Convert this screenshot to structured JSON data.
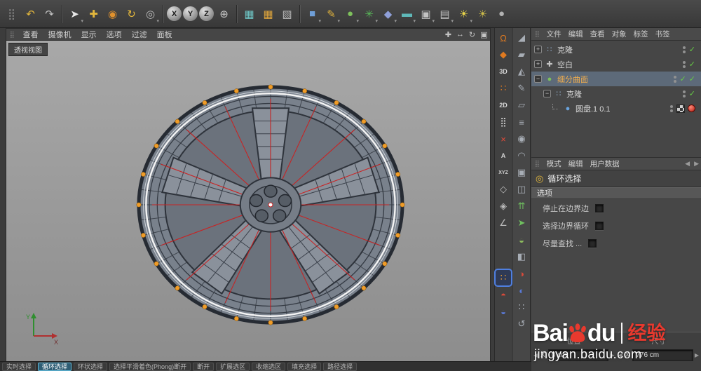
{
  "top_toolbar": {
    "icons": [
      {
        "n": "palette-grip-icon",
        "g": "⣿",
        "c": "#828282"
      },
      {
        "n": "undo-icon",
        "g": "↶",
        "c": "#e3b73c"
      },
      {
        "n": "redo-icon",
        "g": "↷",
        "c": "#c2c2c2"
      },
      {
        "n": "sep"
      },
      {
        "n": "live-selection-icon",
        "g": "➤",
        "c": "#e8e8e8",
        "caret": true
      },
      {
        "n": "move-tool-icon",
        "g": "✚",
        "c": "#e3b73c"
      },
      {
        "n": "scale-tool-icon",
        "g": "◉",
        "c": "#e0912d"
      },
      {
        "n": "rotate-tool-icon",
        "g": "↻",
        "c": "#e3b73c"
      },
      {
        "n": "last-tool-icon",
        "g": "◎",
        "c": "#bcbcbc",
        "caret": true
      },
      {
        "n": "sep"
      },
      {
        "n": "lock-x-button",
        "g": "X",
        "ball": true
      },
      {
        "n": "lock-y-button",
        "g": "Y",
        "ball": true
      },
      {
        "n": "lock-z-button",
        "g": "Z",
        "ball": true
      },
      {
        "n": "coord-system-button",
        "g": "⊕",
        "c": "#c8c8c8"
      },
      {
        "n": "sep"
      },
      {
        "n": "render-view-button",
        "g": "▦",
        "c": "#6fc7c7"
      },
      {
        "n": "render-picture-button",
        "g": "▦",
        "c": "#e0a63c"
      },
      {
        "n": "render-settings-button",
        "g": "▧",
        "c": "#bcbcbc"
      },
      {
        "n": "sep"
      },
      {
        "n": "primitive-cube-button",
        "g": "■",
        "c": "#6f9fd8",
        "caret": true
      },
      {
        "n": "spline-pen-button",
        "g": "✎",
        "c": "#e0b23c",
        "caret": true
      },
      {
        "n": "subdivision-surface-button",
        "g": "●",
        "c": "#7ec15c",
        "caret": true
      },
      {
        "n": "mograph-button",
        "g": "✳",
        "c": "#58b858",
        "caret": true
      },
      {
        "n": "deformer-button",
        "g": "◆",
        "c": "#8f9fd8",
        "caret": true
      },
      {
        "n": "environment-button",
        "g": "▬",
        "c": "#5fb8b8",
        "caret": true
      },
      {
        "n": "camera-button",
        "g": "▣",
        "c": "#c2c2c2",
        "caret": true
      },
      {
        "n": "display-button",
        "g": "▤",
        "c": "#c2c2c2",
        "caret": true
      },
      {
        "n": "light-button",
        "g": "☀",
        "c": "#e8d44a",
        "caret": true
      },
      {
        "n": "light2-button",
        "g": "☀",
        "c": "#c8b84a"
      },
      {
        "n": "material-sphere-button",
        "g": "●",
        "c": "#b2b2b2"
      }
    ]
  },
  "viewport": {
    "menu": [
      "查看",
      "摄像机",
      "显示",
      "选项",
      "过滤",
      "面板"
    ],
    "view_label": "透视视图",
    "view_controls": [
      {
        "n": "pan-view-icon",
        "g": "✚"
      },
      {
        "n": "zoom-view-icon",
        "g": "↔"
      },
      {
        "n": "rotate-view-icon",
        "g": "↻"
      },
      {
        "n": "toggle-view-icon",
        "g": "▣"
      }
    ],
    "axis_labels": {
      "x": "X",
      "y": "Y"
    }
  },
  "tool_column_a": {
    "icons": [
      {
        "n": "snap-enable-icon",
        "g": "Ω",
        "c": "#e07a20"
      },
      {
        "n": "snap-vertex-icon",
        "g": "◆",
        "c": "#e07a20"
      },
      {
        "n": "snap-3d-icon",
        "g": "3D",
        "c": "#d8d8d8",
        "txt": true
      },
      {
        "n": "snap-grid-icon",
        "g": "∷",
        "c": "#e07a20"
      },
      {
        "n": "snap-2d-icon",
        "g": "2D",
        "c": "#d8d8d8",
        "txt": true
      },
      {
        "n": "grid-points-icon",
        "g": "⣿",
        "c": "#d2d2d2"
      },
      {
        "n": "snap-disable-icon",
        "g": "×",
        "c": "#e04a3a"
      },
      {
        "n": "auto-mode-icon",
        "g": "A",
        "c": "#d2d2d2",
        "txt": true
      },
      {
        "n": "axis-xyz-icon",
        "g": "XYZ",
        "c": "#d2d2d2",
        "small": true
      },
      {
        "n": "workplane-icon",
        "g": "◇",
        "c": "#bababa"
      },
      {
        "n": "workplane-lock-icon",
        "g": "◈",
        "c": "#bababa"
      },
      {
        "n": "quantize-icon",
        "g": "∠",
        "c": "#bababa"
      },
      {
        "n": "gap"
      },
      {
        "n": "loop-selection-tool-icon",
        "g": "∷",
        "c": "#f0a030",
        "sel": true
      },
      {
        "n": "axis-modify-icon",
        "g": "◓",
        "c": "#d84a3a"
      },
      {
        "n": "normal-move-icon",
        "g": "◒",
        "c": "#5a7ad8"
      }
    ]
  },
  "tool_column_b": {
    "icons": [
      {
        "n": "tweak-tool-icon",
        "g": "◢",
        "c": "#a8aeb6"
      },
      {
        "n": "extrude-tool-icon",
        "g": "▰",
        "c": "#a8aeb6"
      },
      {
        "n": "bevel-tool-icon",
        "g": "◭",
        "c": "#a8aeb6"
      },
      {
        "n": "knife-tool-icon",
        "g": "✎",
        "c": "#a8aeb6"
      },
      {
        "n": "polygon-pen-icon",
        "g": "▱",
        "c": "#a8aeb6"
      },
      {
        "n": "bridge-tool-icon",
        "g": "≡",
        "c": "#a8aeb6"
      },
      {
        "n": "weld-tool-icon",
        "g": "◉",
        "c": "#a8aeb6"
      },
      {
        "n": "brush-tool-icon",
        "g": "◠",
        "c": "#a8aeb6"
      },
      {
        "n": "close-hole-icon",
        "g": "▣",
        "c": "#a8aeb6"
      },
      {
        "n": "edge-cut-icon",
        "g": "◫",
        "c": "#a8aeb6"
      },
      {
        "n": "smooth-shift-icon",
        "g": "⇈",
        "c": "#6fbf5f"
      },
      {
        "n": "matrix-extrude-icon",
        "g": "➤",
        "c": "#6fbf5f"
      },
      {
        "n": "normal-scale-icon",
        "g": "◒",
        "c": "#8fbf5f"
      },
      {
        "n": "split-tool-icon",
        "g": "◧",
        "c": "#a8aeb6"
      },
      {
        "n": "axis-center-icon",
        "g": "◑",
        "c": "#d84a3a"
      },
      {
        "n": "mirror-tool-icon",
        "g": "◐",
        "c": "#5a7ad8"
      },
      {
        "n": "array-tool-icon",
        "g": "∷",
        "c": "#a8aeb6"
      },
      {
        "n": "reset-tool-icon",
        "g": "↺",
        "c": "#a8aeb6"
      }
    ]
  },
  "object_manager": {
    "menu": [
      "文件",
      "编辑",
      "查看",
      "对象",
      "标签",
      "书签"
    ],
    "items": [
      {
        "label": "克隆",
        "indent": 0,
        "exp": "+",
        "icon": "cloner",
        "selected": false,
        "tags": [
          "dots",
          "check"
        ]
      },
      {
        "label": "空白",
        "indent": 0,
        "exp": "+",
        "icon": "null",
        "selected": false,
        "tags": [
          "dots",
          "check"
        ]
      },
      {
        "label": "细分曲面",
        "indent": 0,
        "exp": "−",
        "icon": "sds",
        "selected": true,
        "tags": [
          "dots",
          "check",
          "check"
        ]
      },
      {
        "label": "克隆",
        "indent": 1,
        "exp": "−",
        "icon": "cloner",
        "selected": false,
        "tags": [
          "dots",
          "check"
        ]
      },
      {
        "label": "圆盘.1 0.1",
        "indent": 2,
        "exp": "",
        "icon": "disc",
        "selected": false,
        "tags": [
          "dots",
          "checker",
          "material"
        ]
      }
    ]
  },
  "attributes": {
    "menu": [
      "模式",
      "编辑",
      "用户数据"
    ],
    "tool": {
      "label": "循环选择"
    },
    "section": "选项",
    "options": [
      {
        "key": "stop-at-boundary-edges",
        "label": "停止在边界边"
      },
      {
        "key": "select-boundary-loop",
        "label": "选择边界循环"
      },
      {
        "key": "find-as-possible",
        "label": "尽量查找 ..."
      }
    ]
  },
  "coords": {
    "pos_label": "位置",
    "size_label": "尺寸",
    "x_label": "X",
    "pos_value": "0 cm",
    "size_value": "776 cm"
  },
  "watermark": {
    "bai": "Bai",
    "du": "du",
    "suffix": "经验",
    "url": "jingyan.baidu.com"
  },
  "bottom_tabs": {
    "active_index": 1,
    "tabs": [
      "实时选择",
      "循环选择",
      "环状选择",
      "选择平滑着色(Phong)断开",
      "断开",
      "扩展选区",
      "收缩选区",
      "填充选择",
      "路径选择"
    ]
  }
}
